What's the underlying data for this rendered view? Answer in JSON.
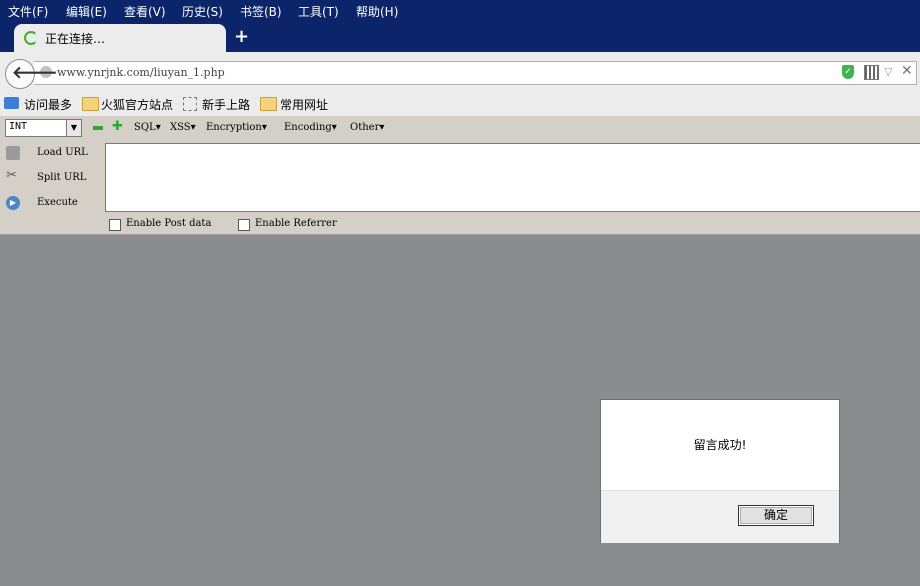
{
  "menu": [
    "文件(F)",
    "编辑(E)",
    "查看(V)",
    "历史(S)",
    "书签(B)",
    "工具(T)",
    "帮助(H)"
  ],
  "tab": {
    "title": "正在连接…",
    "new_tab": "+"
  },
  "nav": {
    "url": "www.ynrjnk.com/liuyan_1.php"
  },
  "bookmarks": [
    {
      "label": "访问最多",
      "icon": "search-bookmark-icon"
    },
    {
      "label": "火狐官方站点",
      "icon": "folder-icon"
    },
    {
      "label": "新手上路",
      "icon": "blank-page-icon"
    },
    {
      "label": "常用网址",
      "icon": "folder-icon"
    }
  ],
  "hackbar": {
    "select_value": "INT",
    "menus": [
      "SQL▾",
      "XSS▾",
      "Encryption▾",
      "Encoding▾",
      "Other▾"
    ],
    "load_url": "Load URL",
    "split_url": "Split URL",
    "execute": "Execute",
    "textarea_value": "",
    "enable_post": "Enable Post data",
    "enable_referrer": "Enable Referrer"
  },
  "dialog": {
    "message": "留言成功!",
    "ok": "确定"
  },
  "colors": {
    "menubar": "#0b246a",
    "chrome": "#ececec",
    "hackbar": "#d4d0c8",
    "page_overlay": "#8b8c8e"
  }
}
